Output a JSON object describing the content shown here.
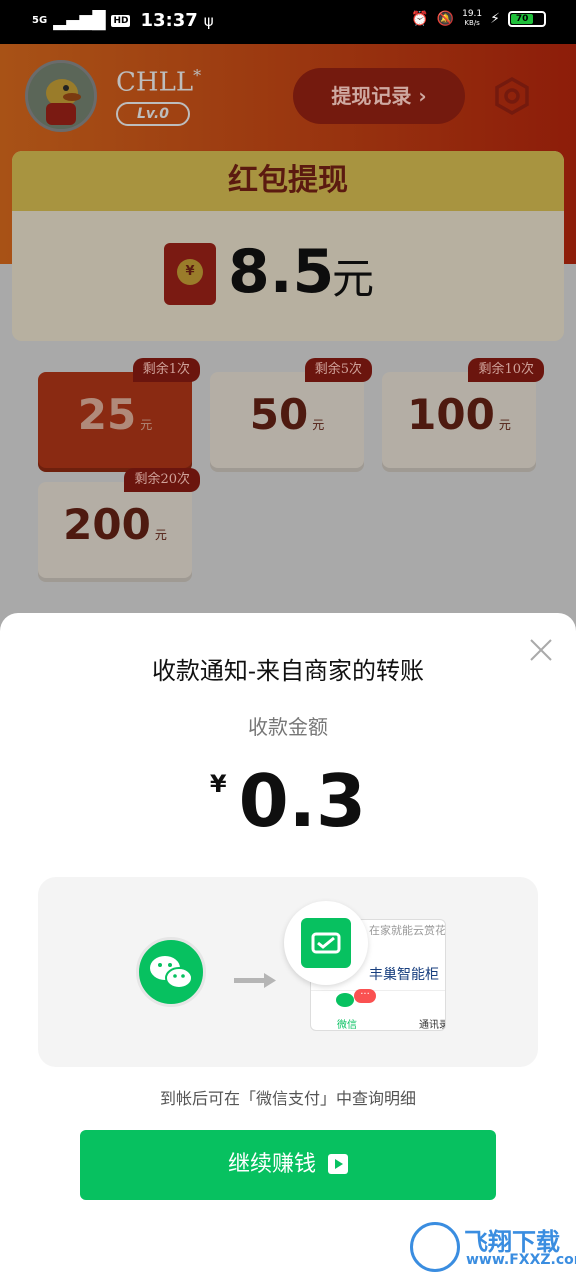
{
  "status_bar": {
    "network": "5G",
    "hd": "HD",
    "time": "13:37",
    "speed_value": "19.1",
    "speed_unit": "KB/s",
    "battery": "70"
  },
  "header": {
    "username": "CHLL",
    "username_mark": "*",
    "level": "Lv.0",
    "withdraw_record": "提现记录 ›"
  },
  "card": {
    "title": "红包提现",
    "amount": "8.5",
    "amount_unit": "元"
  },
  "options": [
    {
      "value": "25",
      "unit": "元",
      "tag": "剩余1次",
      "selected": true
    },
    {
      "value": "50",
      "unit": "元",
      "tag": "剩余5次",
      "selected": false
    },
    {
      "value": "100",
      "unit": "元",
      "tag": "剩余10次",
      "selected": false
    },
    {
      "value": "200",
      "unit": "元",
      "tag": "剩余20次",
      "selected": false
    }
  ],
  "sheet": {
    "title": "收款通知-来自商家的转账",
    "label": "收款金额",
    "currency": "¥",
    "amount": "0.3",
    "illustration": {
      "row1": "在家就能云赏花",
      "row2": "丰巢智能柜",
      "badge": "···",
      "tab_wechat": "微信",
      "tab_contacts": "通讯录"
    },
    "hint": "到帐后可在「微信支付」中查询明细",
    "continue_button": "继续赚钱"
  },
  "watermark": {
    "text": "飞翔下载",
    "sub": "www.FXXZ.com"
  },
  "colors": {
    "wechat_green": "#07c160",
    "header_red": "#8d1d0a"
  }
}
